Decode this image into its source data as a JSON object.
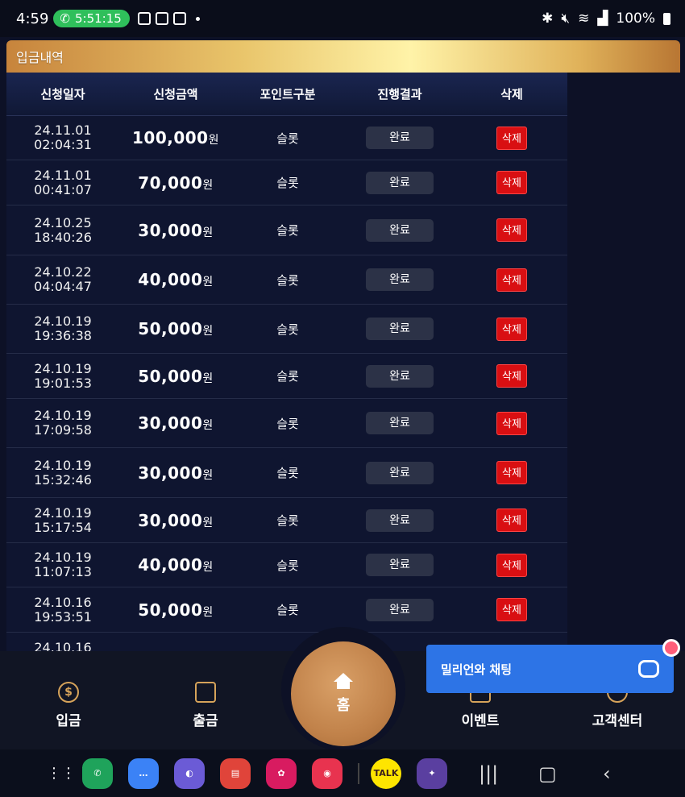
{
  "status_bar": {
    "time": "4:59",
    "call_timer": "5:51:15",
    "battery": "100%",
    "icons": [
      "gallery-icon",
      "b-app-icon",
      "calendar-icon",
      "bluetooth-icon",
      "mute-icon",
      "wifi-icon",
      "signal-icon",
      "battery-icon"
    ]
  },
  "section": {
    "title": "입금내역"
  },
  "table": {
    "headers": [
      "신청일자",
      "신청금액",
      "포인트구분",
      "진행결과",
      "삭제"
    ],
    "rows": [
      {
        "date": "24.11.01 02:04:31",
        "amount": "100,000",
        "unit": "원",
        "type": "슬롯",
        "status": "완료",
        "delete": "삭제"
      },
      {
        "date": "24.11.01 00:41:07",
        "amount": "70,000",
        "unit": "원",
        "type": "슬롯",
        "status": "완료",
        "delete": "삭제"
      },
      {
        "date": "24.10.25 18:40:26",
        "amount": "30,000",
        "unit": "원",
        "type": "슬롯",
        "status": "완료",
        "delete": "삭제"
      },
      {
        "date": "24.10.22 04:04:47",
        "amount": "40,000",
        "unit": "원",
        "type": "슬롯",
        "status": "완료",
        "delete": "삭제"
      },
      {
        "date": "24.10.19 19:36:38",
        "amount": "50,000",
        "unit": "원",
        "type": "슬롯",
        "status": "완료",
        "delete": "삭제"
      },
      {
        "date": "24.10.19 19:01:53",
        "amount": "50,000",
        "unit": "원",
        "type": "슬롯",
        "status": "완료",
        "delete": "삭제"
      },
      {
        "date": "24.10.19 17:09:58",
        "amount": "30,000",
        "unit": "원",
        "type": "슬롯",
        "status": "완료",
        "delete": "삭제"
      },
      {
        "date": "24.10.19 15:32:46",
        "amount": "30,000",
        "unit": "원",
        "type": "슬롯",
        "status": "완료",
        "delete": "삭제"
      },
      {
        "date": "24.10.19 15:17:54",
        "amount": "30,000",
        "unit": "원",
        "type": "슬롯",
        "status": "완료",
        "delete": "삭제"
      },
      {
        "date": "24.10.19 11:07:13",
        "amount": "40,000",
        "unit": "원",
        "type": "슬롯",
        "status": "완료",
        "delete": "삭제"
      },
      {
        "date": "24.10.16 19:53:51",
        "amount": "50,000",
        "unit": "원",
        "type": "슬롯",
        "status": "완료",
        "delete": "삭제"
      },
      {
        "date": "24.10.16",
        "amount": "",
        "unit": "",
        "type": "",
        "status": "",
        "delete": ""
      }
    ]
  },
  "bottom_nav": {
    "deposit": "입금",
    "withdraw": "출금",
    "home": "홈",
    "event": "이벤트",
    "support": "고객센터"
  },
  "chat": {
    "label": "밀리언와 채팅"
  },
  "dock": {
    "apps": [
      "phone-app",
      "messages-app",
      "internet-app",
      "notes-app",
      "gallery-app",
      "camera-app",
      "kakaotalk-app",
      "game-app"
    ],
    "kakao_label": "TALK"
  },
  "colors": {
    "delete": "#d90f12",
    "status": "#2c3247",
    "home": "#c1824a",
    "chat": "#2d74e6"
  }
}
